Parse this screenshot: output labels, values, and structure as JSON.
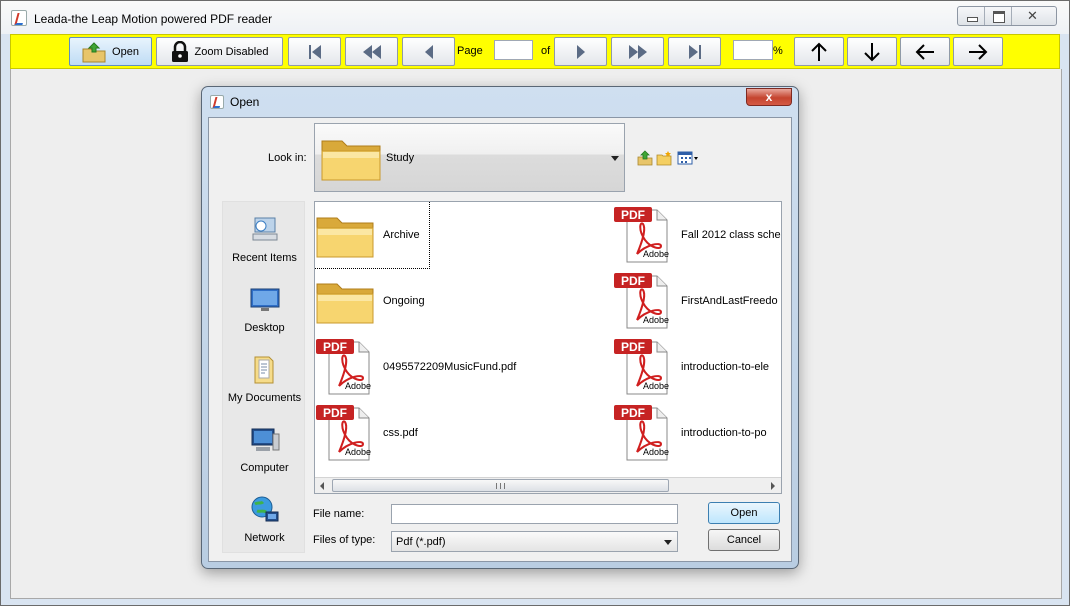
{
  "app": {
    "title": "Leada-the Leap Motion powered PDF reader"
  },
  "toolbar": {
    "open_label": "Open",
    "zoom_label": "Zoom Disabled",
    "page_label": "Page",
    "of_label": "of",
    "page_value": "",
    "zoom_value": "",
    "percent_label": "%"
  },
  "dialog": {
    "title": "Open",
    "close_label": "x",
    "look_in_label": "Look in:",
    "look_in_value": "Study",
    "places": [
      {
        "label": "Recent Items",
        "icon": "recent-items-icon"
      },
      {
        "label": "Desktop",
        "icon": "desktop-icon"
      },
      {
        "label": "My Documents",
        "icon": "my-documents-icon"
      },
      {
        "label": "Computer",
        "icon": "computer-icon"
      },
      {
        "label": "Network",
        "icon": "network-icon"
      }
    ],
    "files": [
      {
        "name": "Archive",
        "type": "folder"
      },
      {
        "name": "Ongoing",
        "type": "folder"
      },
      {
        "name": "0495572209MusicFund.pdf",
        "type": "pdf"
      },
      {
        "name": "css.pdf",
        "type": "pdf"
      },
      {
        "name": "Fall 2012 class sche",
        "type": "pdf"
      },
      {
        "name": "FirstAndLastFreedo",
        "type": "pdf"
      },
      {
        "name": "introduction-to-ele",
        "type": "pdf"
      },
      {
        "name": "introduction-to-po",
        "type": "pdf"
      }
    ],
    "pdf_badge": "PDF",
    "adobe_label": "Adobe",
    "file_name_label": "File name:",
    "file_name_value": "",
    "file_type_label": "Files of type:",
    "file_type_value": "Pdf (*.pdf)",
    "open_button": "Open",
    "cancel_button": "Cancel"
  }
}
